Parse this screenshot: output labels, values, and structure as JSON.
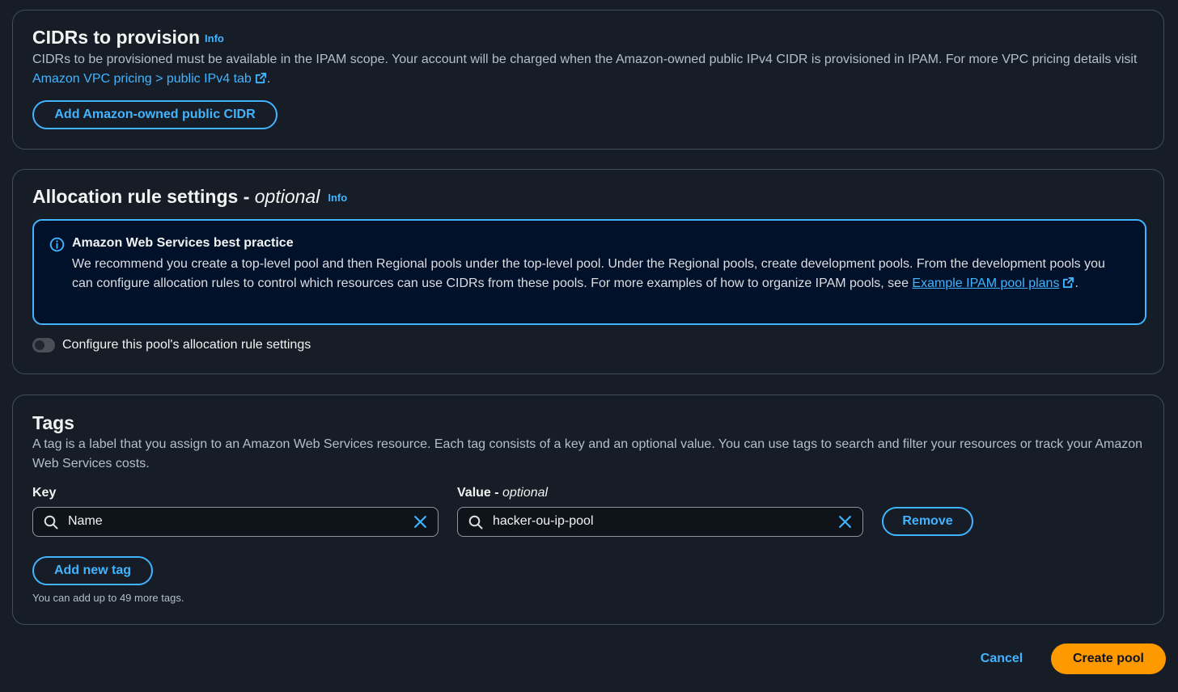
{
  "cidrs_section": {
    "title": "CIDRs to provision",
    "info": "Info",
    "description": "CIDRs to be provisioned must be available in the IPAM scope. Your account will be charged when the Amazon-owned public IPv4 CIDR is provisioned in IPAM. For more VPC pricing details visit",
    "pricing_link": "Amazon VPC pricing > public IPv4 tab",
    "period": ".",
    "add_button": "Add Amazon-owned public CIDR"
  },
  "allocation_section": {
    "title": "Allocation rule settings - ",
    "title_optional": "optional",
    "info": "Info",
    "alert": {
      "title": "Amazon Web Services best practice",
      "body": "We recommend you create a top-level pool and then Regional pools under the top-level pool. Under the Regional pools, create development pools. From the development pools you can configure allocation rules to control which resources can use CIDRs from these pools. For more examples of how to organize IPAM pools, see",
      "link": "Example IPAM pool plans",
      "period": "."
    },
    "toggle_label": "Configure this pool's allocation rule settings",
    "toggle_on": false
  },
  "tags_section": {
    "title": "Tags",
    "description": "A tag is a label that you assign to an Amazon Web Services resource. Each tag consists of a key and an optional value. You can use tags to search and filter your resources or track your Amazon Web Services costs.",
    "key_label": "Key",
    "value_label": "Value - ",
    "value_optional": "optional",
    "tags": [
      {
        "key": "Name",
        "value": "hacker-ou-ip-pool"
      }
    ],
    "remove_button": "Remove",
    "add_button": "Add new tag",
    "hint": "You can add up to 49 more tags."
  },
  "footer": {
    "cancel": "Cancel",
    "create": "Create pool"
  },
  "colors": {
    "background": "#161d26",
    "accent": "#42b4ff",
    "primary": "#ff9900",
    "alert_background": "#001129"
  }
}
